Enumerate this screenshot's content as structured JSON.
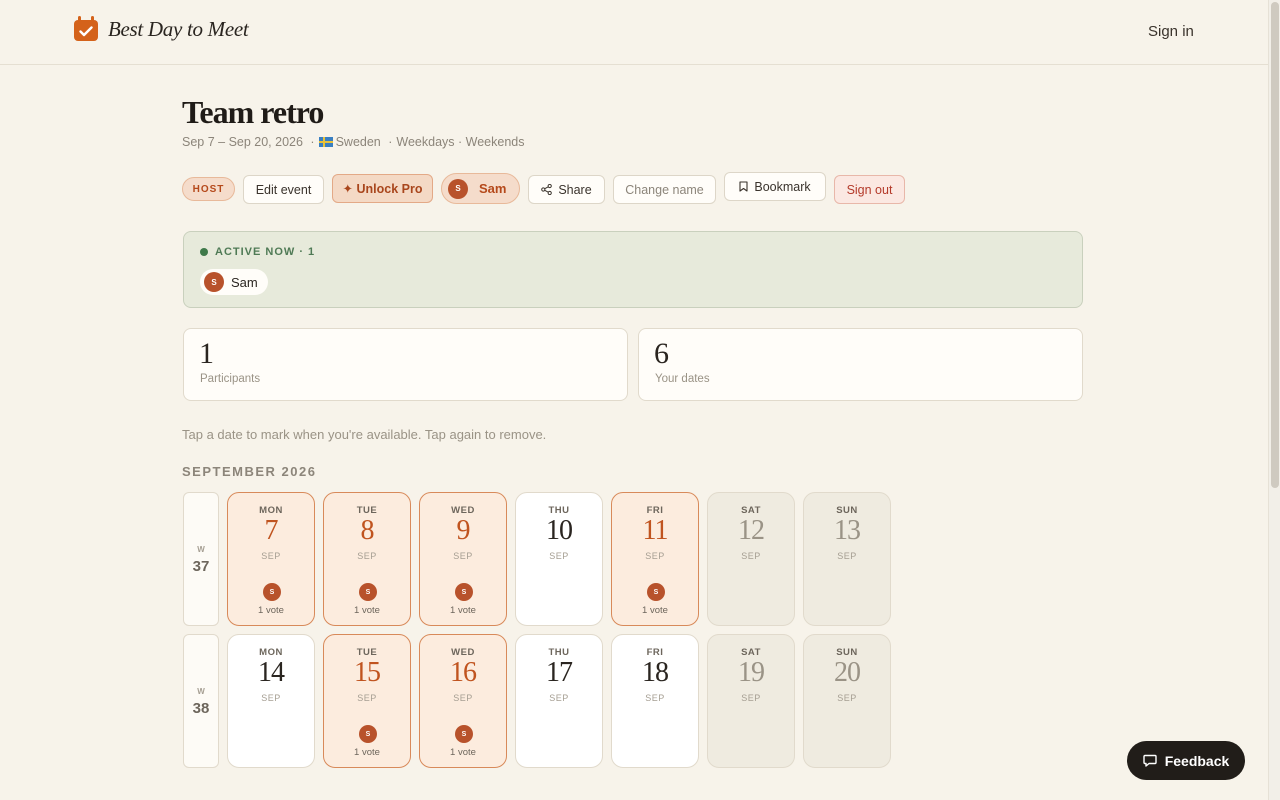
{
  "app": {
    "brand": "Best Day to Meet",
    "signin": "Sign in"
  },
  "event": {
    "title": "Team retro",
    "date_range": "Sep 7 – Sep 20, 2026",
    "country": "Sweden",
    "day_types": "Weekdays · Weekends"
  },
  "actions": {
    "host": "HOST",
    "edit": "Edit event",
    "pro": "✦ Unlock Pro",
    "user_initial": "S",
    "user": "Sam",
    "share": "Share",
    "change_name": "Change name",
    "bookmark": "Bookmark",
    "signout": "Sign out"
  },
  "active": {
    "label": "ACTIVE NOW · 1",
    "users": [
      {
        "initial": "S",
        "name": "Sam"
      }
    ]
  },
  "stats": [
    {
      "value": "1",
      "label": "Participants"
    },
    {
      "value": "6",
      "label": "Your dates"
    }
  ],
  "hint": "Tap a date to mark when you're available. Tap again to remove.",
  "calendar": {
    "month": "SEPTEMBER 2026",
    "week_prefix": "W",
    "weeks": [
      {
        "number": "37",
        "days": [
          {
            "dow": "MON",
            "day": "7",
            "month": "SEP",
            "selected": true,
            "voter": "S",
            "votes": "1 vote"
          },
          {
            "dow": "TUE",
            "day": "8",
            "month": "SEP",
            "selected": true,
            "voter": "S",
            "votes": "1 vote"
          },
          {
            "dow": "WED",
            "day": "9",
            "month": "SEP",
            "selected": true,
            "voter": "S",
            "votes": "1 vote"
          },
          {
            "dow": "THU",
            "day": "10",
            "month": "SEP",
            "selected": false
          },
          {
            "dow": "FRI",
            "day": "11",
            "month": "SEP",
            "selected": true,
            "voter": "S",
            "votes": "1 vote"
          },
          {
            "dow": "SAT",
            "day": "12",
            "month": "SEP",
            "weekend": true
          },
          {
            "dow": "SUN",
            "day": "13",
            "month": "SEP",
            "weekend": true
          }
        ]
      },
      {
        "number": "38",
        "days": [
          {
            "dow": "MON",
            "day": "14",
            "month": "SEP",
            "selected": false
          },
          {
            "dow": "TUE",
            "day": "15",
            "month": "SEP",
            "selected": true,
            "voter": "S",
            "votes": "1 vote"
          },
          {
            "dow": "WED",
            "day": "16",
            "month": "SEP",
            "selected": true,
            "voter": "S",
            "votes": "1 vote"
          },
          {
            "dow": "THU",
            "day": "17",
            "month": "SEP",
            "selected": false
          },
          {
            "dow": "FRI",
            "day": "18",
            "month": "SEP",
            "selected": false
          },
          {
            "dow": "SAT",
            "day": "19",
            "month": "SEP",
            "weekend": true
          },
          {
            "dow": "SUN",
            "day": "20",
            "month": "SEP",
            "weekend": true
          }
        ]
      }
    ]
  },
  "feedback": "Feedback",
  "colors": {
    "accent": "#c0541f",
    "active_bg": "#e7eadb",
    "dark": "#211d19"
  }
}
